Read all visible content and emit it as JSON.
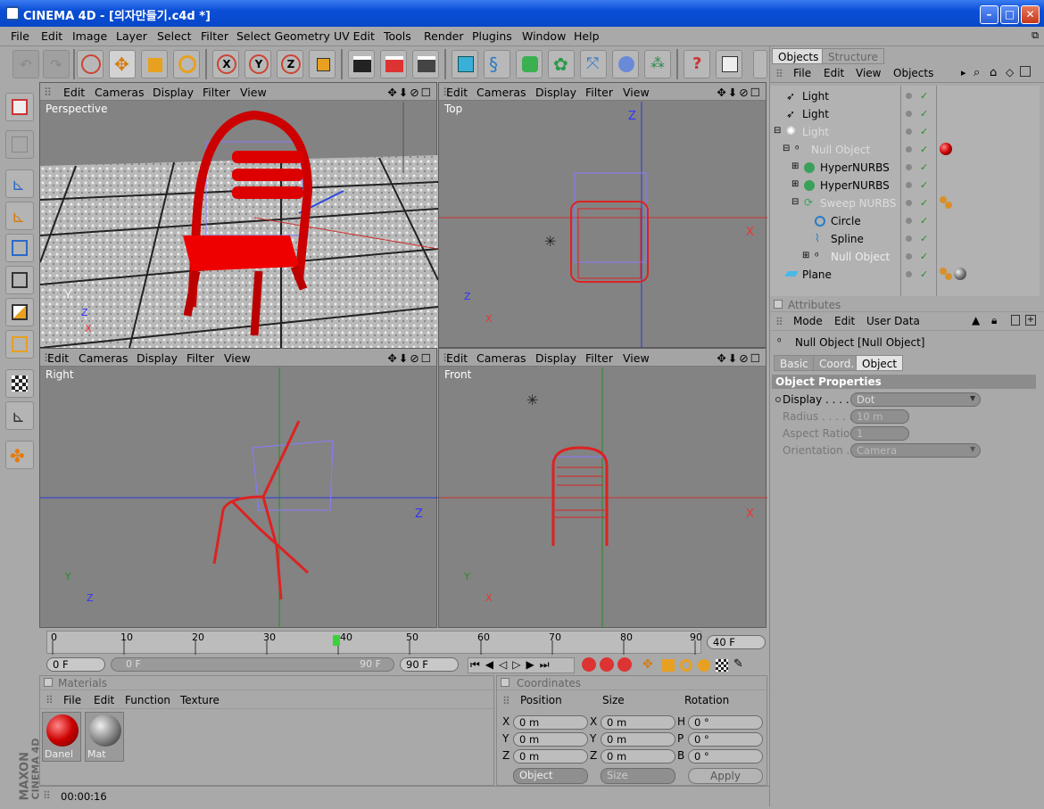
{
  "window": {
    "title": "CINEMA 4D - [의자만들기.c4d *]"
  },
  "menu": [
    "File",
    "Edit",
    "Image",
    "Layer",
    "Select",
    "Filter",
    "Select Geometry",
    "UV Edit",
    "Tools",
    "Render",
    "Plugins",
    "Window",
    "Help"
  ],
  "viewport_menu": [
    "Edit",
    "Cameras",
    "Display",
    "Filter",
    "View"
  ],
  "viewports": {
    "perspective": "Perspective",
    "top": "Top",
    "right": "Right",
    "front": "Front"
  },
  "axis": {
    "x": "X",
    "y": "Y",
    "z": "Z"
  },
  "timeline": {
    "ticks": [
      "0",
      "10",
      "20",
      "30",
      "40",
      "50",
      "60",
      "70",
      "80",
      "90"
    ],
    "current_frame": "40 F",
    "start": "0 F",
    "range_start": "0 F",
    "range_end": "90 F",
    "end": "90 F"
  },
  "materials": {
    "title": "Materials",
    "menu": [
      "File",
      "Edit",
      "Function",
      "Texture"
    ],
    "items": [
      {
        "name": "Danel"
      },
      {
        "name": "Mat"
      }
    ]
  },
  "coordinates": {
    "title": "Coordinates",
    "headers": [
      "Position",
      "Size",
      "Rotation"
    ],
    "rows": [
      {
        "a": "X",
        "pos": "0 m",
        "b": "X",
        "size": "0 m",
        "c": "H",
        "rot": "0 °"
      },
      {
        "a": "Y",
        "pos": "0 m",
        "b": "Y",
        "size": "0 m",
        "c": "P",
        "rot": "0 °"
      },
      {
        "a": "Z",
        "pos": "0 m",
        "b": "Z",
        "size": "0 m",
        "c": "B",
        "rot": "0 °"
      }
    ],
    "mode": "Object",
    "size_mode": "Size",
    "apply": "Apply"
  },
  "status": {
    "time": "00:00:16"
  },
  "objects": {
    "tabs": [
      "Objects",
      "Structure"
    ],
    "menu": [
      "File",
      "Edit",
      "View",
      "Objects"
    ],
    "rows": [
      {
        "name": "Light"
      },
      {
        "name": "Light"
      },
      {
        "name": "Light"
      },
      {
        "name": "Null Object"
      },
      {
        "name": "HyperNURBS"
      },
      {
        "name": "HyperNURBS"
      },
      {
        "name": "Sweep NURBS"
      },
      {
        "name": "Circle"
      },
      {
        "name": "Spline"
      },
      {
        "name": "Null Object"
      },
      {
        "name": "Plane"
      }
    ]
  },
  "attributes": {
    "title": "Attributes",
    "menu": [
      "Mode",
      "Edit",
      "User Data"
    ],
    "object": "Null Object [Null Object]",
    "tabs": [
      "Basic",
      "Coord.",
      "Object"
    ],
    "section": "Object Properties",
    "fields": [
      {
        "label": "Display . . . . .",
        "value": "Dot"
      },
      {
        "label": "Radius . . . . .",
        "value": "10 m"
      },
      {
        "label": "Aspect Ratio",
        "value": "1"
      },
      {
        "label": "Orientation . .",
        "value": "Camera"
      }
    ]
  },
  "brand": {
    "line1": "MAXON",
    "line2": "CINEMA 4D"
  }
}
